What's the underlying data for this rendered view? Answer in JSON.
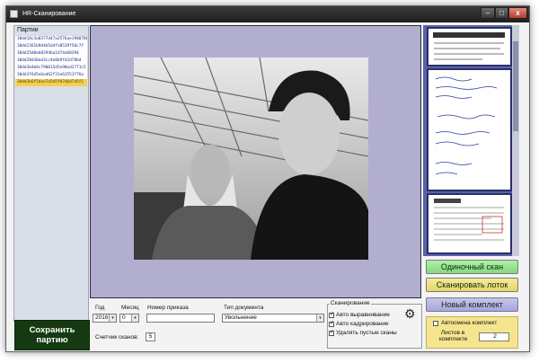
{
  "window": {
    "title": "HR-Сканирование",
    "min_glyph": "–",
    "max_glyph": "□",
    "close_glyph": "x"
  },
  "batches": {
    "header": "Партии",
    "items": [
      "30dd18c3a0377d47a2576ae1900780",
      "30dd2361b9d4b5d4fa8539f50c7f",
      "30dd25d0eb8294ba2d74a60394",
      "30dd28d30ad3cc4e8b9fd2d78bd",
      "30dd3b4b8c790615d5e98ed2771c5",
      "30dd3f6d5e6ed62f31e63551f76a",
      "30dd3b6f5dae7a5d5f07d6d7d5f1"
    ],
    "selected_index": 6,
    "save_button_line1": "Сохранить",
    "save_button_line2": "партию"
  },
  "preview": {
    "image_alt": "photo"
  },
  "actions": {
    "single_scan": "Одиночный скан",
    "scan_tray": "Сканировать лоток",
    "new_set": "Новый комплект",
    "auto_set_label": "Автосмена комплект",
    "auto_set_checked": false,
    "sheets_label_line1": "Листов в",
    "sheets_label_line2": "комплекте",
    "sheets_value": "2"
  },
  "form": {
    "year_label": "Год",
    "year_value": "2016",
    "month_label": "Месяц",
    "month_value": "0",
    "order_label": "Номер приказа",
    "order_value": "",
    "doctype_label": "Тип документа",
    "doctype_value": "Увольнение",
    "scan_counter_label": "Счетчик сканов:",
    "scan_counter_value": "5",
    "dropdown_glyph": "▾"
  },
  "scanning": {
    "group_title": "Сканирование",
    "auto_align": "Авто выравнивание",
    "auto_align_checked": true,
    "auto_crop": "Авто кадрирование",
    "auto_crop_checked": true,
    "remove_blank": "Удалять пустые сканы",
    "remove_blank_checked": true,
    "settings_glyph": "⚙"
  },
  "colors": {
    "preview_bg": "#b2aed0",
    "save_button_bg": "#153a12",
    "selected_batch": "#f2cf54",
    "single_scan_bg": "#86d97f",
    "scan_tray_bg": "#e7d56a",
    "new_set_bg": "#a9a3de"
  }
}
